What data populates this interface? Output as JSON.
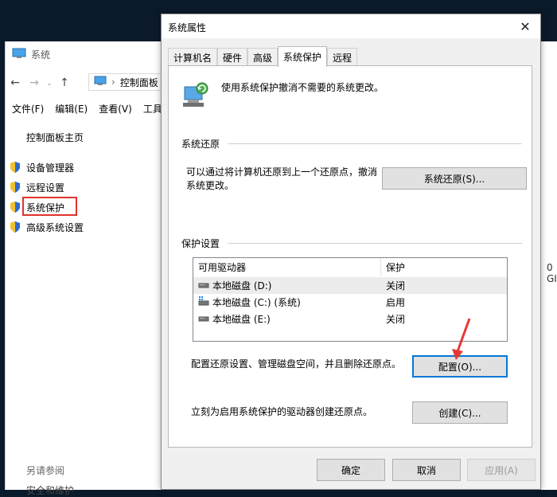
{
  "background_window": {
    "title": "系统",
    "address": {
      "path": "控制面板"
    },
    "menu": [
      "文件(F)",
      "编辑(E)",
      "查看(V)",
      "工具"
    ],
    "left_nav": {
      "home": "控制面板主页",
      "items": [
        "设备管理器",
        "远程设置",
        "系统保护",
        "高级系统设置"
      ]
    },
    "see_also": "另请参阅",
    "security_maintenance": "安全和维护",
    "clipped_text": "0 GI"
  },
  "dialog": {
    "title": "系统属性",
    "tabs": [
      "计算机名",
      "硬件",
      "高级",
      "系统保护",
      "远程"
    ],
    "active_tab": "系统保护",
    "intro": "使用系统保护撤消不需要的系统更改。",
    "restore": {
      "group_label": "系统还原",
      "description": "可以通过将计算机还原到上一个还原点，撤消系统更改。",
      "button": "系统还原(S)..."
    },
    "protection": {
      "group_label": "保护设置",
      "columns": [
        "可用驱动器",
        "保护"
      ],
      "drives": [
        {
          "name": "本地磁盘 (D:)",
          "status": "关闭",
          "selected": true
        },
        {
          "name": "本地磁盘 (C:) (系统)",
          "status": "启用",
          "selected": false
        },
        {
          "name": "本地磁盘 (E:)",
          "status": "关闭",
          "selected": false
        }
      ],
      "configure_desc": "配置还原设置、管理磁盘空间，并且删除还原点。",
      "configure_button": "配置(O)...",
      "create_desc": "立刻为启用系统保护的驱动器创建还原点。",
      "create_button": "创建(C)..."
    },
    "buttons": {
      "ok": "确定",
      "cancel": "取消",
      "apply": "应用(A)"
    }
  },
  "colors": {
    "highlight": "#e0332f",
    "focus": "#0078d7",
    "arrow": "#e53935"
  }
}
